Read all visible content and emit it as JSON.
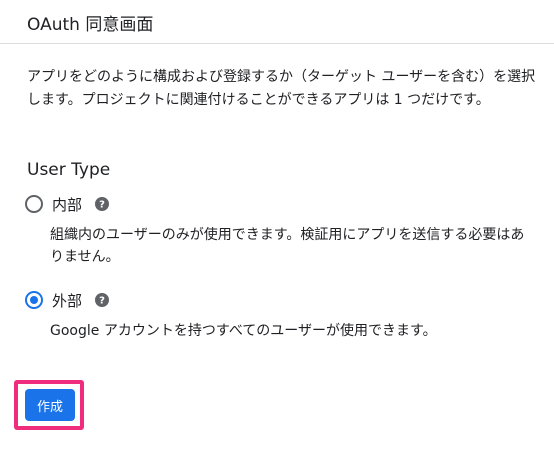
{
  "header": {
    "title": "OAuth 同意画面"
  },
  "intro": {
    "text": "アプリをどのように構成および登録するか（ターゲット ユーザーを含む）を選択します。プロジェクトに関連付けることができるアプリは 1 つだけです。"
  },
  "user_type": {
    "title": "User Type",
    "options": [
      {
        "label": "内部",
        "selected": false,
        "description": "組織内のユーザーのみが使用できます。検証用にアプリを送信する必要はありません。",
        "help_icon": "help-icon"
      },
      {
        "label": "外部",
        "selected": true,
        "description": "Google アカウントを持つすべてのユーザーが使用できます。",
        "help_icon": "help-icon"
      }
    ]
  },
  "actions": {
    "create_label": "作成"
  },
  "colors": {
    "accent": "#1a73e8",
    "highlight": "#f02d7d",
    "help_icon": "#5f6368"
  }
}
